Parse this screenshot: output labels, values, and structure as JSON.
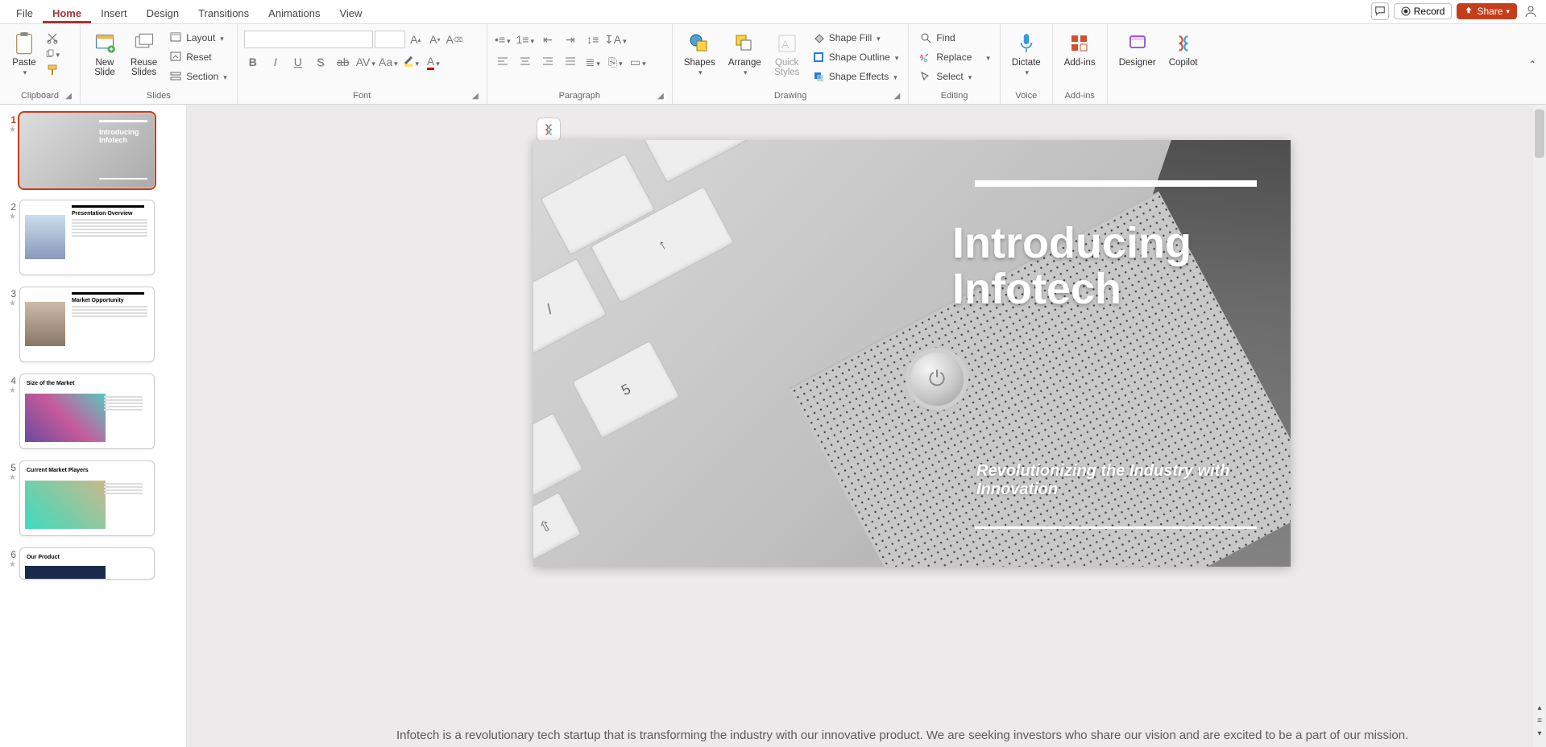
{
  "tabs": {
    "file": "File",
    "home": "Home",
    "insert": "Insert",
    "design": "Design",
    "transitions": "Transitions",
    "animations": "Animations",
    "view": "View"
  },
  "titlebar": {
    "record": "Record",
    "share": "Share"
  },
  "ribbon": {
    "clipboard": {
      "label": "Clipboard",
      "paste": "Paste"
    },
    "slides": {
      "label": "Slides",
      "newSlide": "New\nSlide",
      "reuse": "Reuse\nSlides",
      "layout": "Layout",
      "reset": "Reset",
      "section": "Section"
    },
    "font": {
      "label": "Font"
    },
    "paragraph": {
      "label": "Paragraph"
    },
    "drawing": {
      "label": "Drawing",
      "shapes": "Shapes",
      "arrange": "Arrange",
      "quick": "Quick\nStyles",
      "fill": "Shape Fill",
      "outline": "Shape Outline",
      "effects": "Shape Effects"
    },
    "editing": {
      "label": "Editing",
      "find": "Find",
      "replace": "Replace",
      "select": "Select"
    },
    "voice": {
      "label": "Voice",
      "dictate": "Dictate"
    },
    "addins": {
      "label": "Add-ins",
      "addins": "Add-ins"
    },
    "right": {
      "designer": "Designer",
      "copilot": "Copilot"
    }
  },
  "thumbs": [
    {
      "n": "1",
      "title": "Introducing Infotech"
    },
    {
      "n": "2",
      "title": "Presentation Overview"
    },
    {
      "n": "3",
      "title": "Market Opportunity"
    },
    {
      "n": "4",
      "title": "Size of the Market"
    },
    {
      "n": "5",
      "title": "Current Market Players"
    },
    {
      "n": "6",
      "title": "Our Product"
    }
  ],
  "slide": {
    "title": "Introducing Infotech",
    "subtitle": "Revolutionizing the Industry with Innovation"
  },
  "notes": "Infotech is a revolutionary tech startup that is transforming the industry with our innovative product. We are seeking investors who share our vision and are excited to be a part of our mission."
}
